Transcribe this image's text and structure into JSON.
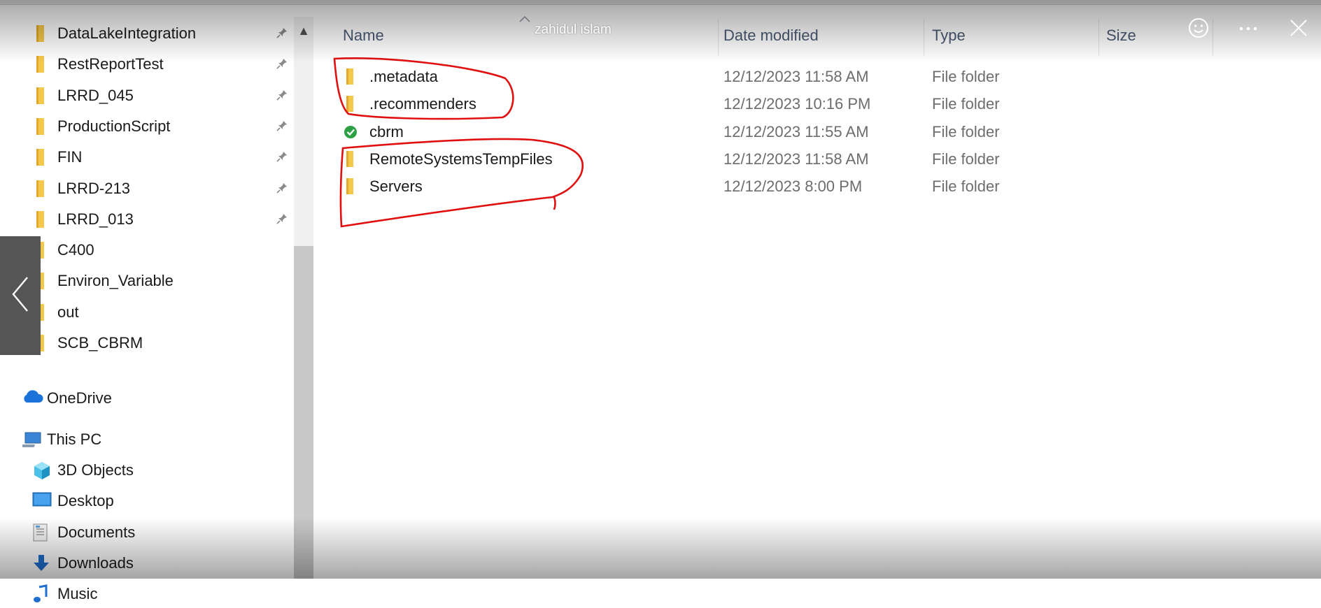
{
  "sidebar": {
    "quick_access": [
      {
        "label": "DataLakeIntegration",
        "pinned": true
      },
      {
        "label": "RestReportTest",
        "pinned": true
      },
      {
        "label": "LRRD_045",
        "pinned": true
      },
      {
        "label": "ProductionScript",
        "pinned": true
      },
      {
        "label": "FIN",
        "pinned": true
      },
      {
        "label": "LRRD-213",
        "pinned": true
      },
      {
        "label": "LRRD_013",
        "pinned": true
      },
      {
        "label": "C400",
        "pinned": false
      },
      {
        "label": "Environ_Variable",
        "pinned": false
      },
      {
        "label": "out",
        "pinned": false
      },
      {
        "label": "SCB_CBRM",
        "pinned": false
      }
    ],
    "onedrive": {
      "label": "OneDrive"
    },
    "this_pc": {
      "label": "This PC"
    },
    "pc_items": [
      {
        "label": "3D Objects",
        "icon": "3d-objects-icon"
      },
      {
        "label": "Desktop",
        "icon": "desktop-icon"
      },
      {
        "label": "Documents",
        "icon": "documents-icon"
      },
      {
        "label": "Downloads",
        "icon": "downloads-icon"
      },
      {
        "label": "Music",
        "icon": "music-icon"
      }
    ]
  },
  "columns": {
    "name": "Name",
    "date_modified": "Date modified",
    "type": "Type",
    "size": "Size"
  },
  "files": [
    {
      "name": ".metadata",
      "date": "12/12/2023 11:58 AM",
      "type": "File folder",
      "icon": "folder-icon"
    },
    {
      "name": ".recommenders",
      "date": "12/12/2023 10:16 PM",
      "type": "File folder",
      "icon": "folder-icon"
    },
    {
      "name": "cbrm",
      "date": "12/12/2023 11:55 AM",
      "type": "File folder",
      "icon": "synced-check-icon"
    },
    {
      "name": "RemoteSystemsTempFiles",
      "date": "12/12/2023 11:58 AM",
      "type": "File folder",
      "icon": "folder-icon"
    },
    {
      "name": "Servers",
      "date": "12/12/2023 8:00 PM",
      "type": "File folder",
      "icon": "folder-icon"
    }
  ],
  "viewer": {
    "user": "zahidul islam"
  },
  "colors": {
    "folder": "#f4c84a",
    "annotation": "#e01010",
    "header_text": "#4a5a72",
    "onedrive": "#1b72d8"
  }
}
